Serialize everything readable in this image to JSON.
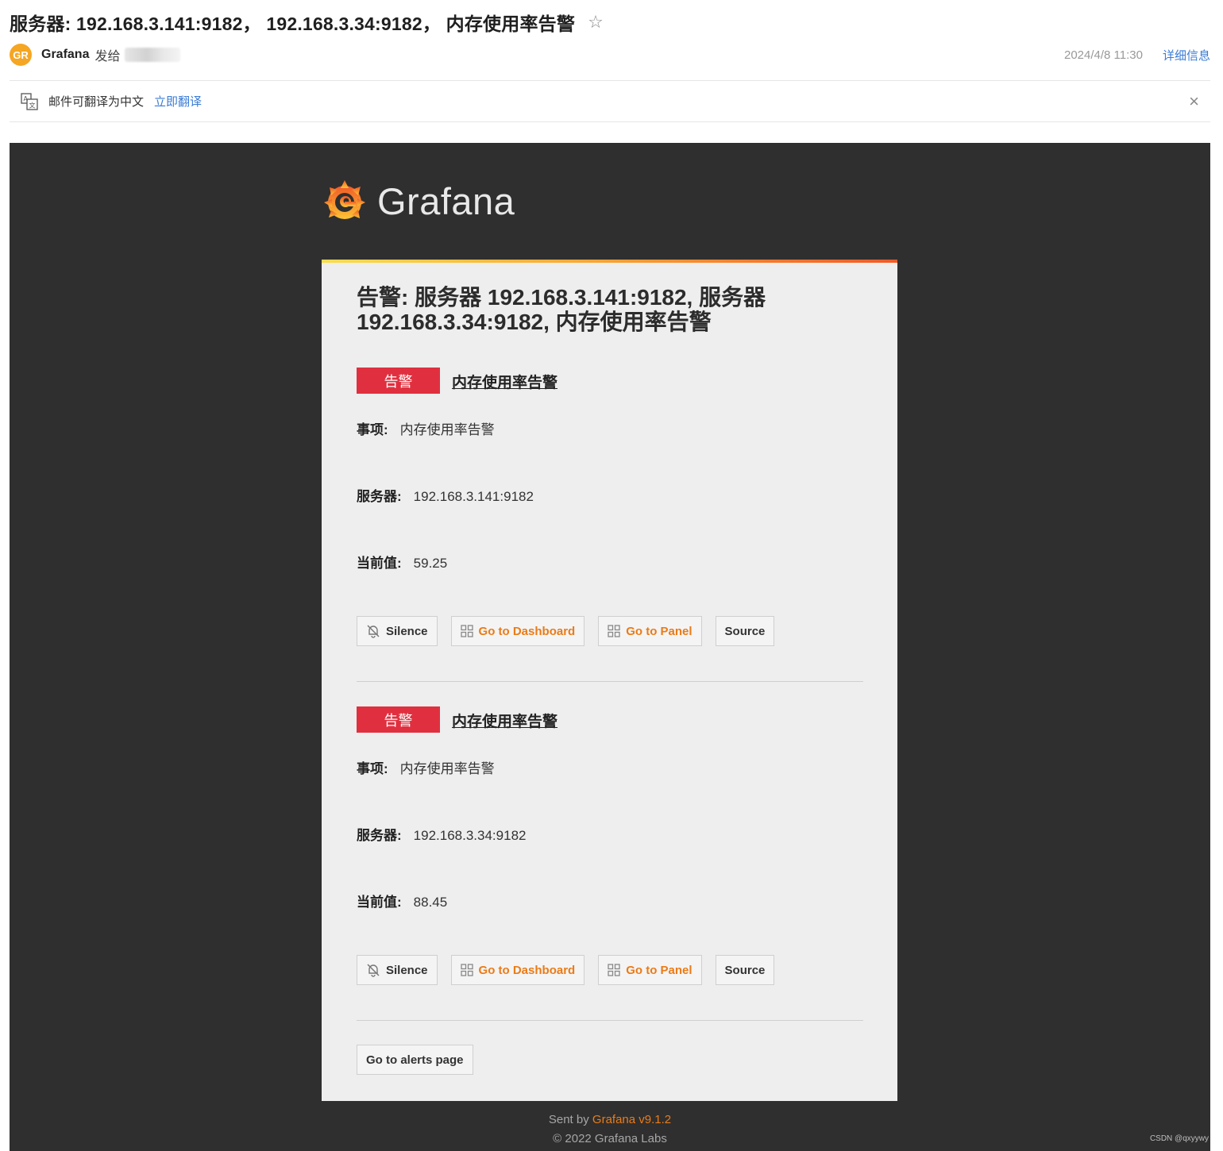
{
  "email": {
    "subject": "服务器: 192.168.3.141:9182， 192.168.3.34:9182， 内存使用率告警",
    "star_icon": "star-outline-icon",
    "avatar_initials": "GR",
    "sender_name": "Grafana",
    "send_to_label": "发给",
    "date": "2024/4/8 11:30",
    "detail_link": "详细信息"
  },
  "translate_bar": {
    "icon": "translate-icon",
    "text": "邮件可翻译为中文",
    "link": "立即翻译",
    "close": "×"
  },
  "body": {
    "logo_text": "Grafana",
    "card_title": "告警: 服务器 192.168.3.141:9182, 服务器 192.168.3.34:9182, 内存使用率告警",
    "alerts": [
      {
        "status": "告警",
        "name": "内存使用率告警",
        "fields": [
          {
            "label": "事项:",
            "value": "内存使用率告警"
          },
          {
            "label": "服务器:",
            "value": "192.168.3.141:9182"
          },
          {
            "label": "当前值:",
            "value": "59.25"
          }
        ],
        "buttons": {
          "silence": "Silence",
          "dashboard": "Go to Dashboard",
          "panel": "Go to Panel",
          "source": "Source"
        }
      },
      {
        "status": "告警",
        "name": "内存使用率告警",
        "fields": [
          {
            "label": "事项:",
            "value": "内存使用率告警"
          },
          {
            "label": "服务器:",
            "value": "192.168.3.34:9182"
          },
          {
            "label": "当前值:",
            "value": "88.45"
          }
        ],
        "buttons": {
          "silence": "Silence",
          "dashboard": "Go to Dashboard",
          "panel": "Go to Panel",
          "source": "Source"
        }
      }
    ],
    "alerts_page_button": "Go to alerts page",
    "footer": {
      "sent_by": "Sent by",
      "brand_version": "Grafana v9.1.2",
      "copyright": "© 2022 Grafana Labs"
    },
    "watermark": "CSDN @qxyywy"
  },
  "colors": {
    "accent_orange": "#eb7b18",
    "alert_red": "#e0303f",
    "link_blue": "#3a7bd5",
    "dark_bg": "#2f2f2f"
  }
}
